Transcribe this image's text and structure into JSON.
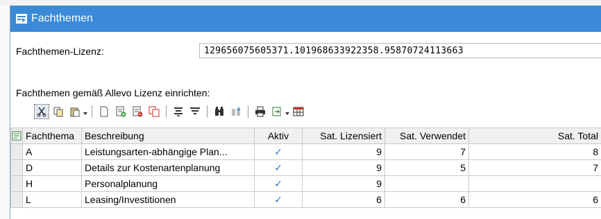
{
  "dialog": {
    "title": "Fachthemen",
    "license_label": "Fachthemen-Lizenz:",
    "license_value": "129656075605371.101968633922358.95870724113663",
    "section_label": "Fachthemen gemäß Allevo Lizenz einrichten:"
  },
  "toolbar": {
    "icons": [
      "cut-icon",
      "copy-icon",
      "paste-icon",
      "new-row-icon",
      "insert-row-icon",
      "delete-row-icon",
      "duplicate-row-icon",
      "sort-icon",
      "filter-icon",
      "find-icon",
      "find-next-icon",
      "print-icon",
      "export-icon",
      "layout-icon"
    ]
  },
  "table": {
    "columns": [
      "Fachthema",
      "Beschreibung",
      "Aktiv",
      "Sat. Lizensiert",
      "Sat. Verwendet",
      "Sat. Total"
    ],
    "rows": [
      {
        "fachthema": "A",
        "beschreibung": "Leistungsarten-abhängige Plan...",
        "aktiv": "✓",
        "lizensiert": "9",
        "verwendet": "7",
        "total": "8"
      },
      {
        "fachthema": "D",
        "beschreibung": "Details zur Kostenartenplanung",
        "aktiv": "✓",
        "lizensiert": "9",
        "verwendet": "5",
        "total": "7"
      },
      {
        "fachthema": "H",
        "beschreibung": "Personalplanung",
        "aktiv": "✓",
        "lizensiert": "9",
        "verwendet": "",
        "total": ""
      },
      {
        "fachthema": "L",
        "beschreibung": "Leasing/Investitionen",
        "aktiv": "✓",
        "lizensiert": "6",
        "verwendet": "6",
        "total": "6"
      }
    ]
  },
  "colors": {
    "titlebar": "#3a8ad8",
    "check": "#2a73d0",
    "grid_border": "#c9c9c9"
  }
}
